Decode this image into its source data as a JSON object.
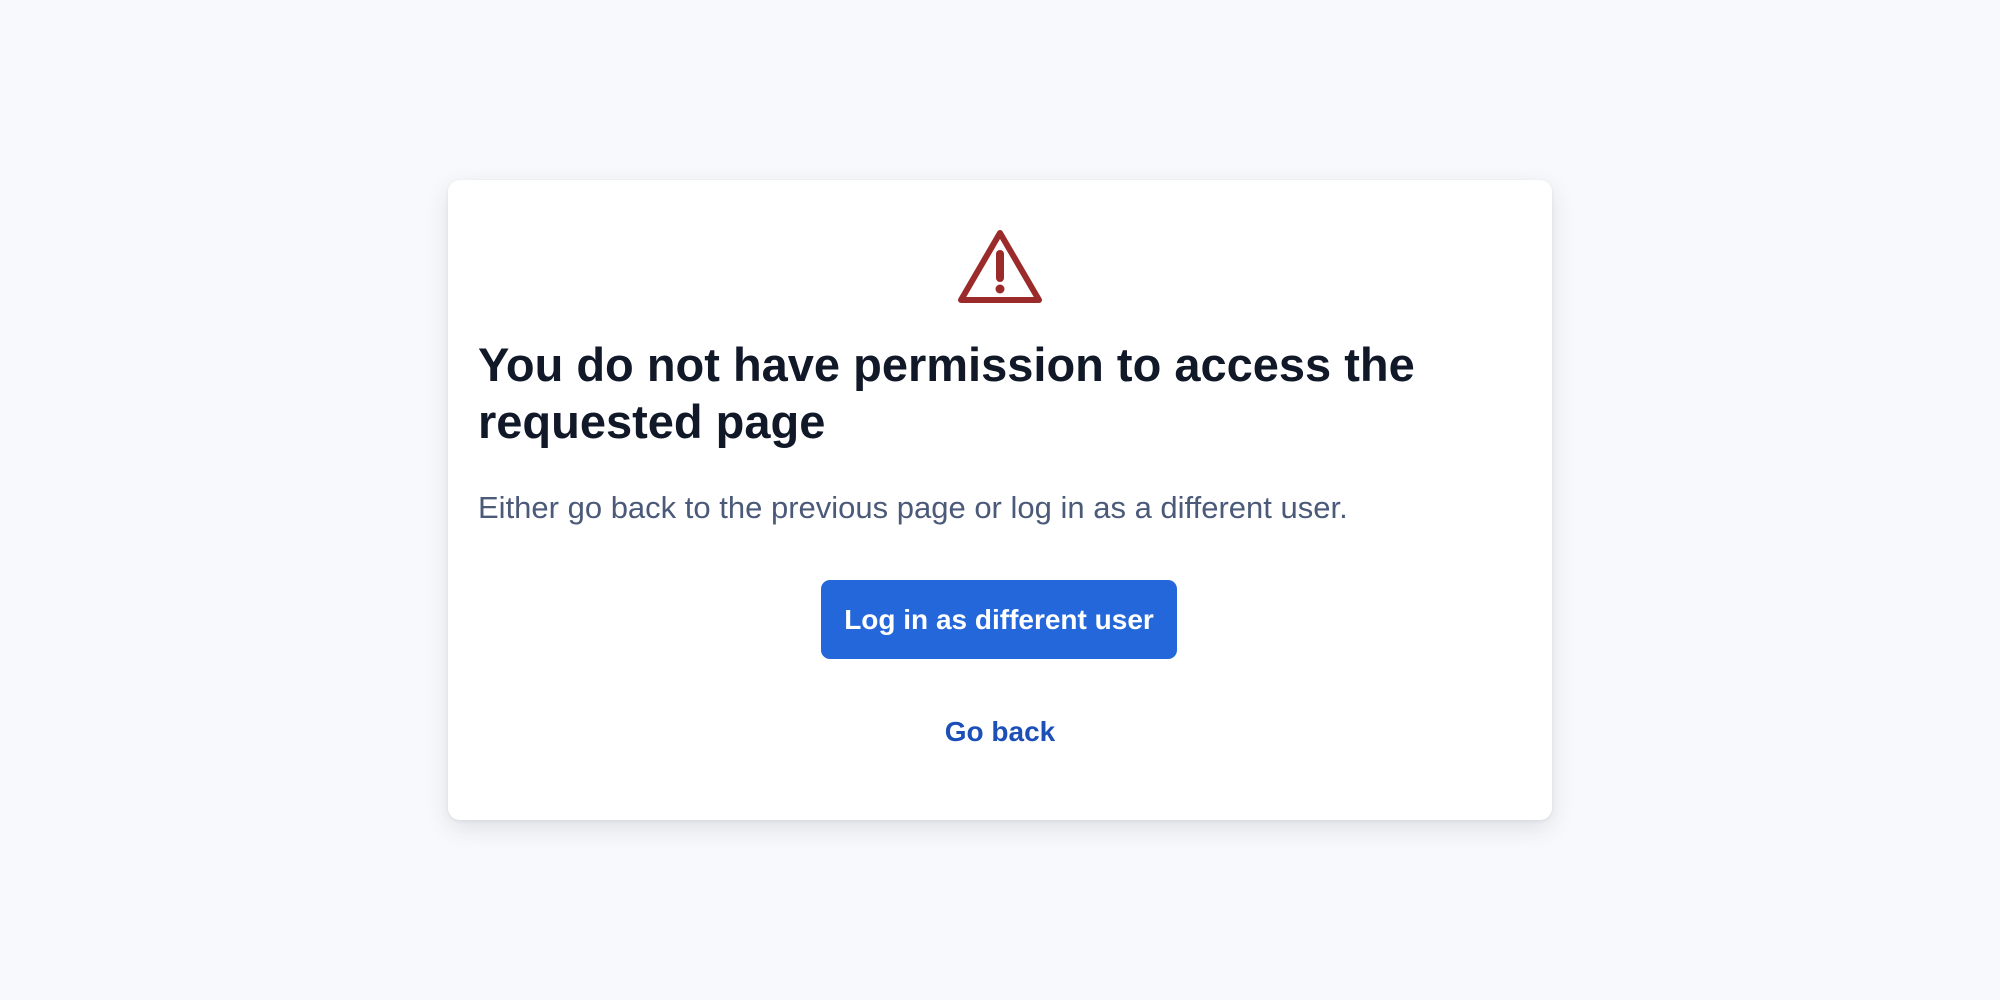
{
  "dialog": {
    "icon": "warning-triangle-icon",
    "icon_color": "#9b2a2a",
    "title": "You do not have permission to access the requested page",
    "message": "Either go back to the previous page or log in as a different user.",
    "primary_button": "Log in as different user",
    "primary_color": "#2367db",
    "secondary_link": "Go back"
  }
}
